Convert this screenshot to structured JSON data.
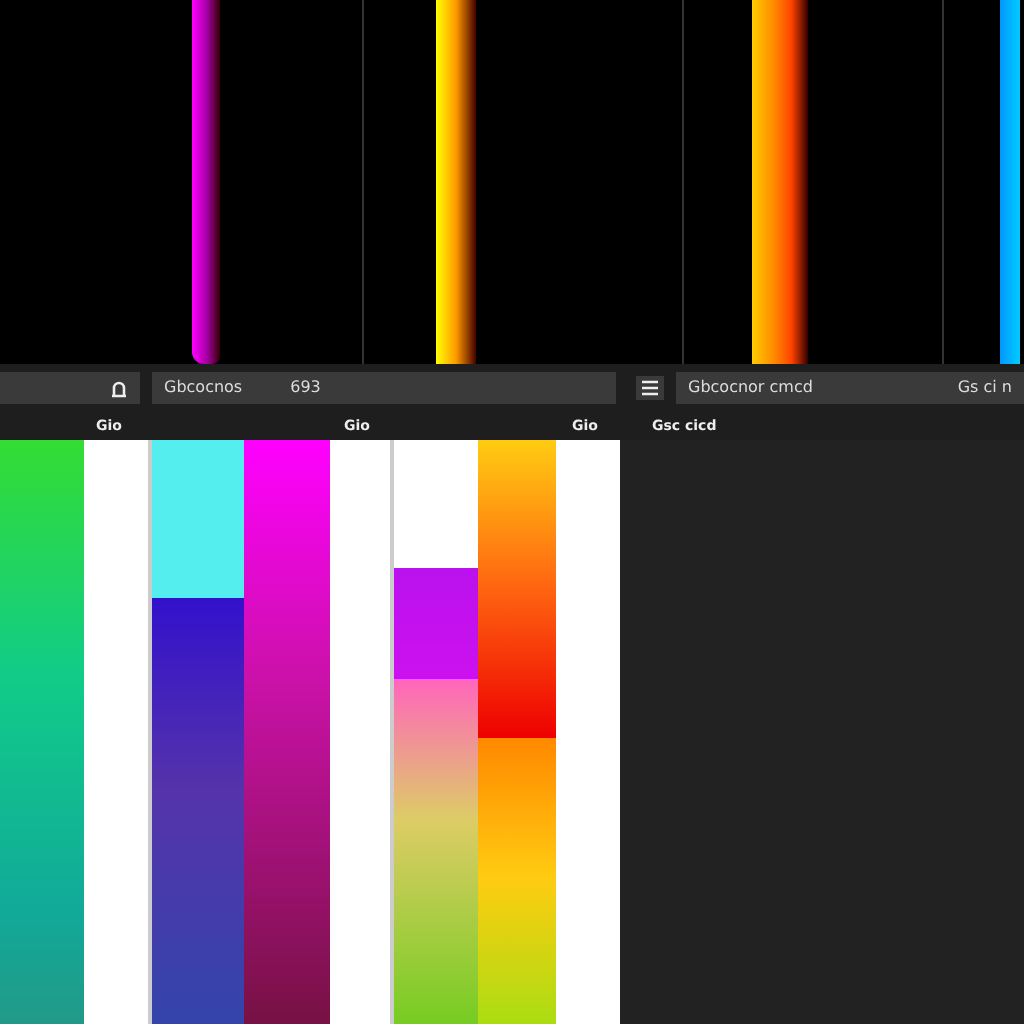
{
  "toolbar": {
    "left_field": {
      "label": "Gbcocnos",
      "value": "693"
    },
    "right_field": {
      "value": "Gbcocnor cmcd",
      "suffix": "Gs ci n"
    }
  },
  "labels": [
    "Gio",
    "Gio",
    "Gio",
    "Gsc cicd"
  ]
}
